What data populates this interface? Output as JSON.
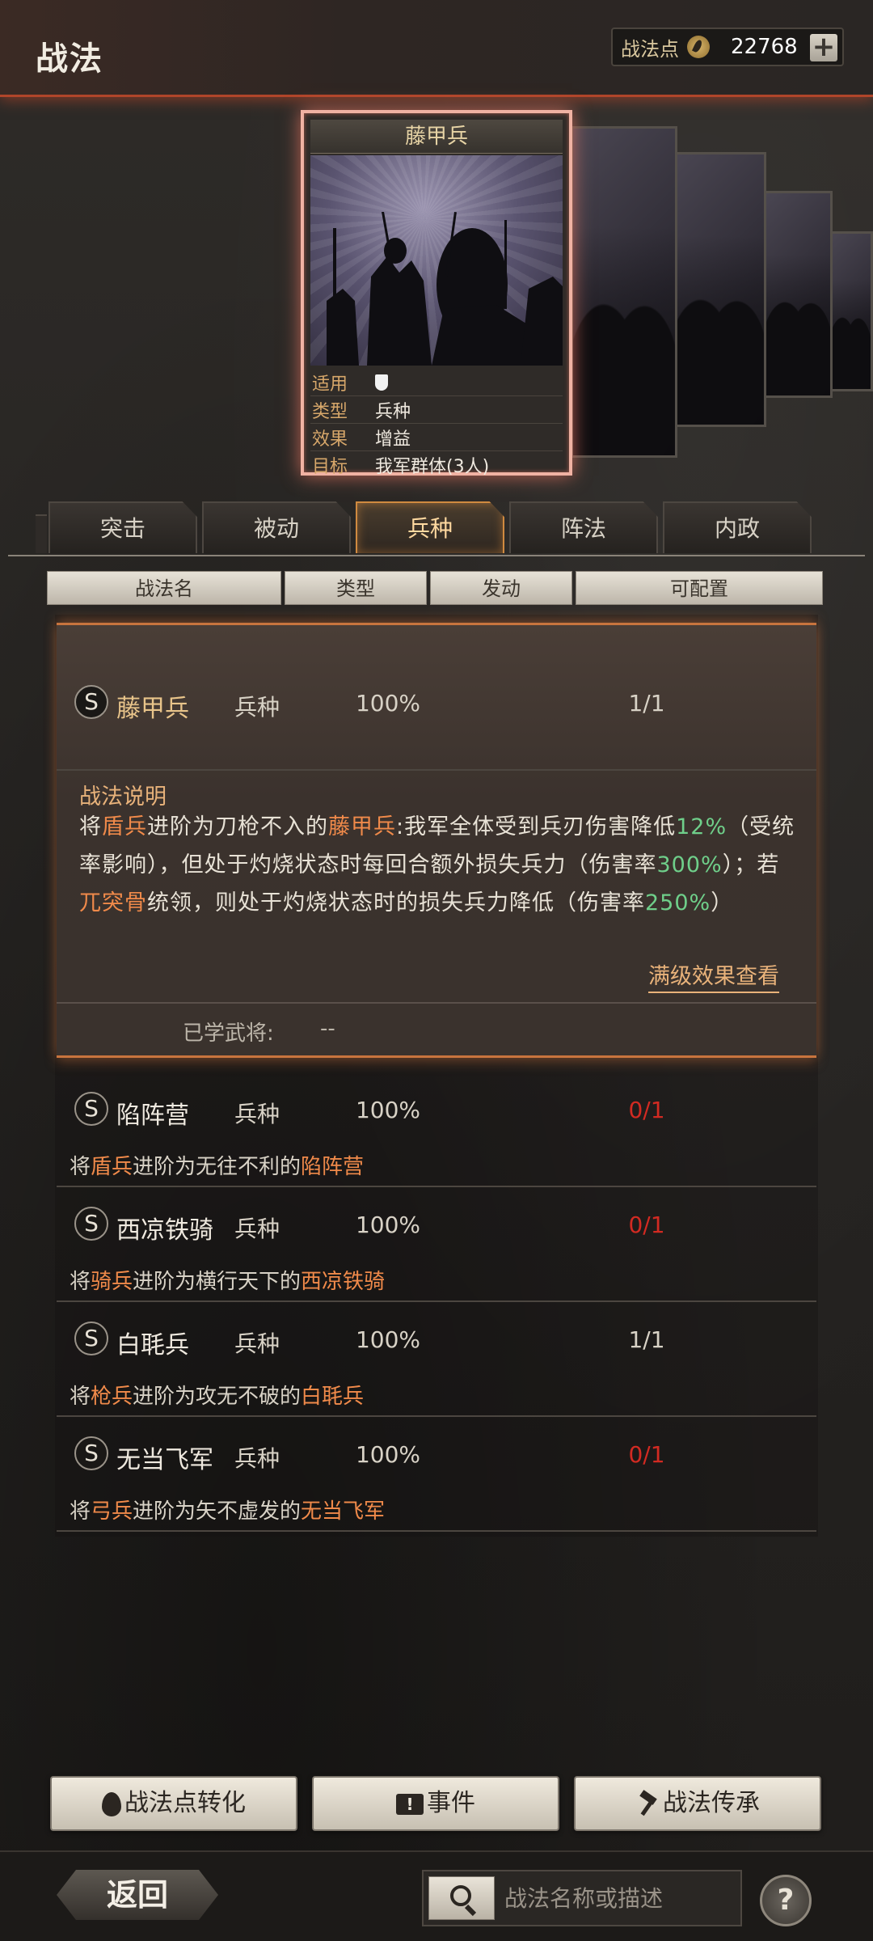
{
  "header": {
    "title": "战法",
    "points_label": "战法点",
    "points_value": "22768",
    "plus": "+"
  },
  "card": {
    "title": "藤甲兵",
    "rows": [
      {
        "key": "适用",
        "value": ""
      },
      {
        "key": "类型",
        "value": "兵种"
      },
      {
        "key": "效果",
        "value": "增益"
      },
      {
        "key": "目标",
        "value": "我军群体(3人)"
      }
    ]
  },
  "tabs": [
    "突击",
    "被动",
    "兵种",
    "阵法",
    "内政"
  ],
  "columns": [
    "战法名",
    "类型",
    "发动",
    "可配置"
  ],
  "expanded": {
    "badge": "S",
    "name": "藤甲兵",
    "type": "兵种",
    "rate": "100%",
    "count": "1/1",
    "desc_title": "战法说明",
    "desc": {
      "p1": "将",
      "h1": "盾兵",
      "p2": "进阶为刀枪不入的",
      "h2": "藤甲兵",
      "p3": ":我军全体受到兵刃伤害降低",
      "g1": "12%",
      "p4": "（受统率影响），但处于灼烧状态时每回合额外损失兵力（伤害率",
      "g2": "300%",
      "p5": "）；若",
      "h3": "兀突骨",
      "p6": "统领，则处于灼烧状态时的损失兵力降低（伤害率",
      "g3": "250%",
      "p7": "）"
    },
    "full_level_link": "满级效果查看",
    "learned_label": "已学武将:",
    "learned_value": "--"
  },
  "rows": [
    {
      "badge": "S",
      "name": "陷阵营",
      "type": "兵种",
      "rate": "100%",
      "count": "0/1",
      "d1": "将",
      "d2": "盾兵",
      "d3": "进阶为无往不利的",
      "d4": "陷阵营"
    },
    {
      "badge": "S",
      "name": "西凉铁骑",
      "type": "兵种",
      "rate": "100%",
      "count": "0/1",
      "d1": "将",
      "d2": "骑兵",
      "d3": "进阶为横行天下的",
      "d4": "西凉铁骑"
    },
    {
      "badge": "S",
      "name": "白毦兵",
      "type": "兵种",
      "rate": "100%",
      "count": "1/1",
      "d1": "将",
      "d2": "枪兵",
      "d3": "进阶为攻无不破的",
      "d4": "白毦兵"
    },
    {
      "badge": "S",
      "name": "无当飞军",
      "type": "兵种",
      "rate": "100%",
      "count": "0/1",
      "d1": "将",
      "d2": "弓兵",
      "d3": "进阶为矢不虚发的",
      "d4": "无当飞军"
    }
  ],
  "buttons": {
    "convert": "战法点转化",
    "event": "事件",
    "inherit": "战法传承"
  },
  "footer": {
    "back": "返回",
    "search_placeholder": "战法名称或描述",
    "help": "?"
  },
  "colors": {
    "accent_orange": "#f08a4a",
    "accent_green": "#6fcf8a",
    "count_red": "#d22a22",
    "card_glow": "#f0b2a3"
  }
}
